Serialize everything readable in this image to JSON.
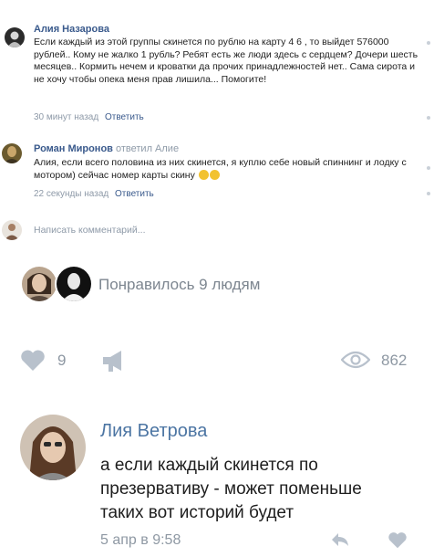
{
  "comments": [
    {
      "author": "Алия Назарова",
      "reply_to": "",
      "text": "Если каждый из этой группы скинется по рублю на карту 4          6 , то выйдет 576000 рублей.. Кому не жалко 1 рубль? Ребят есть же люди здесь с сердцем? Дочери шесть месяцев.. Кормить нечем и кроватки да прочих принадлежностей нет.. Сама сирота и не хочу чтобы опека меня прав лишила... Помогите!",
      "time": "30 минут назад",
      "reply_label": "Ответить"
    },
    {
      "author": "Роман Миронов",
      "reply_to": "ответил Алие",
      "text": "Алия, если всего половина из них скинется, я куплю себе новый спиннинг и лодку с мотором) сейчас номер карты скину",
      "time": "22 секунды назад",
      "reply_label": "Ответить"
    }
  ],
  "write_comment_placeholder": "Написать комментарий...",
  "likes": {
    "text": "Понравилось 9 людям"
  },
  "actions": {
    "like_count": "9",
    "views_count": "862"
  },
  "reply": {
    "author": "Лия Ветрова",
    "text_lines": [
      "а если каждый скинется по",
      "презервативу - может поменьше",
      "таких вот историй будет"
    ],
    "time": "5 апр в 9:58"
  },
  "colors": {
    "accent": "#4c75a3",
    "muted": "#8e98a3",
    "text": "#1e1e1e"
  }
}
